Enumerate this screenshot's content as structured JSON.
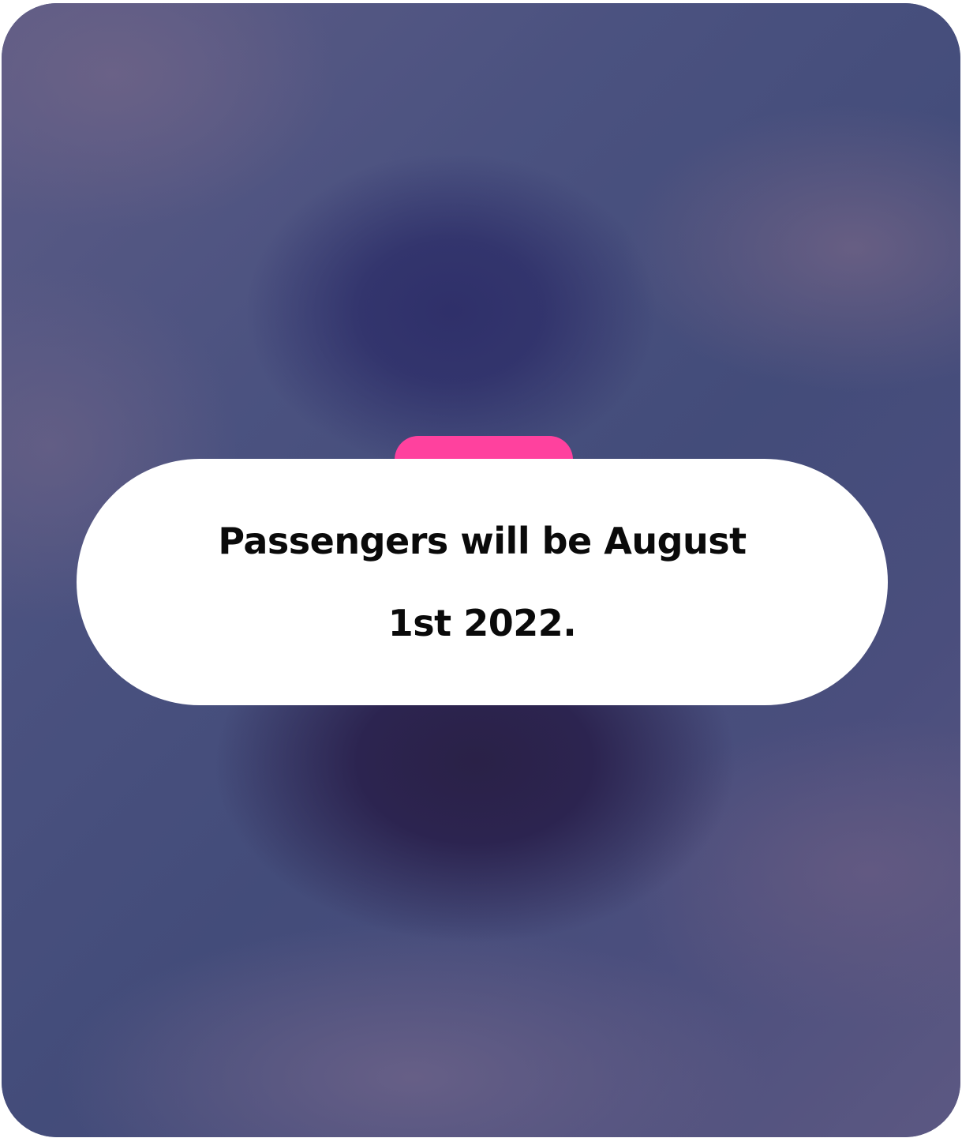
{
  "card": {
    "background_colors": [
      "#2a2147",
      "#2f306a",
      "#4a4f7c",
      "#6b6286"
    ],
    "accent_color": "#ff419e"
  },
  "message": {
    "text": "Passengers will be August 1st 2022."
  }
}
